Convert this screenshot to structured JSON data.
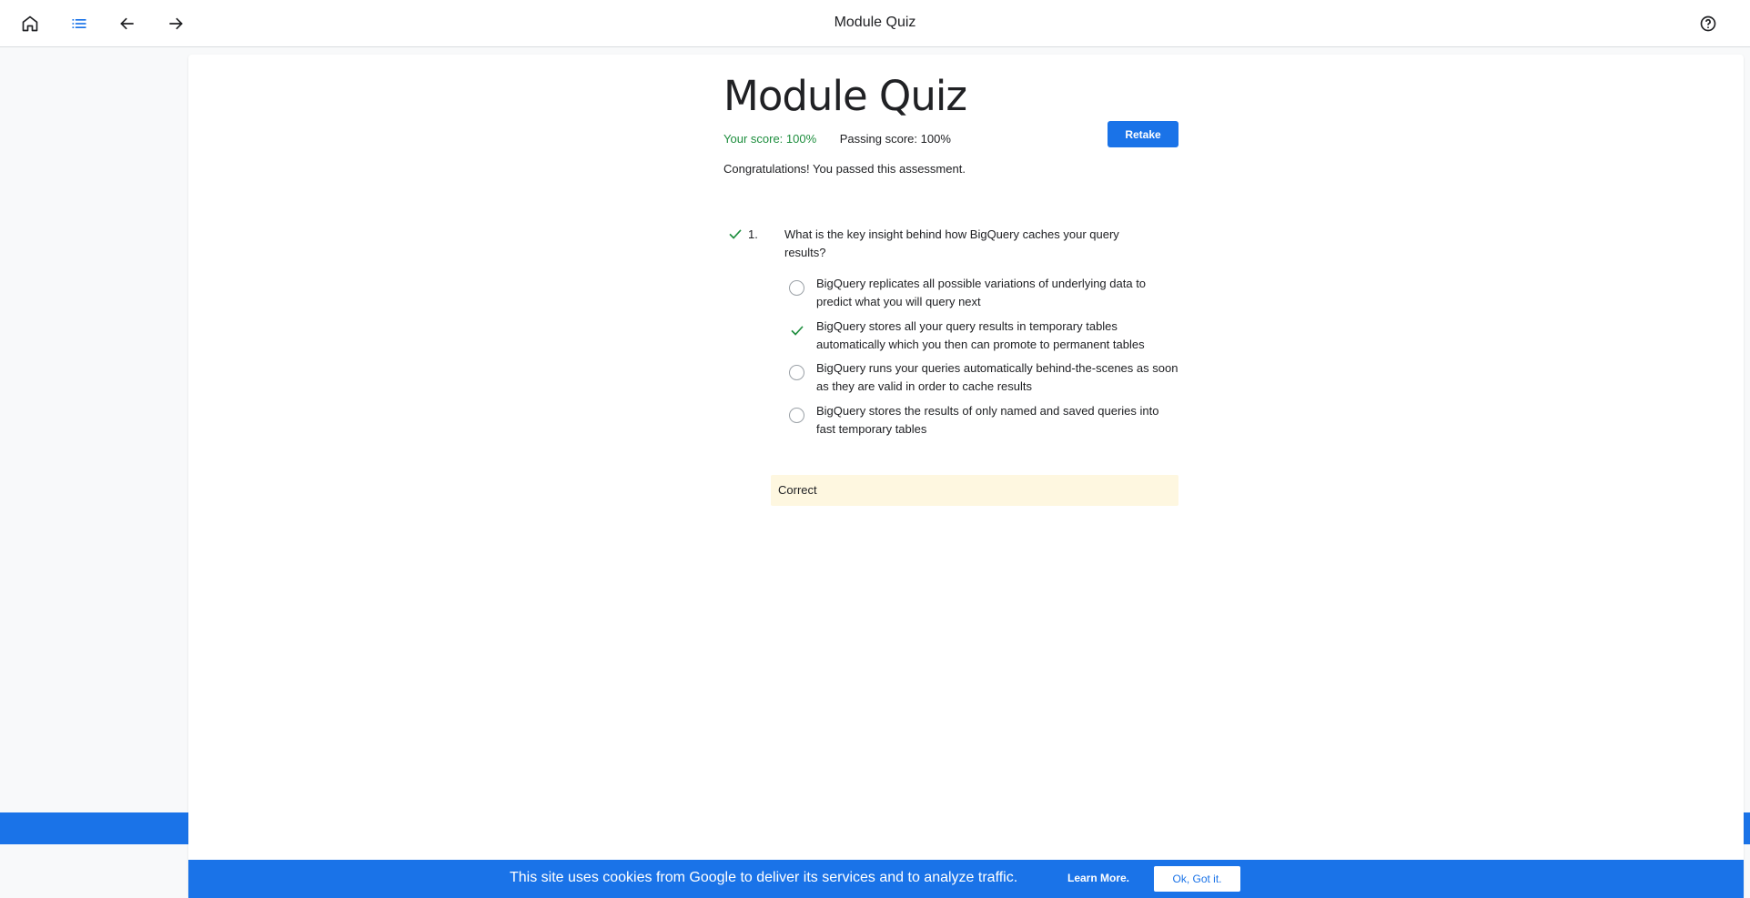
{
  "topbar": {
    "title": "Module Quiz",
    "icons": [
      "home-icon",
      "list-icon",
      "arrow-back-icon",
      "arrow-forward-icon",
      "help-icon"
    ]
  },
  "quiz": {
    "title": "Module Quiz",
    "your_score": "Your score: 100%",
    "passing_score": "Passing score: 100%",
    "retake_label": "Retake",
    "congrats": "Congratulations! You passed this assessment."
  },
  "question": {
    "number": "1.",
    "text": "What is the key insight behind how BigQuery caches your query results?",
    "options": [
      {
        "text": "BigQuery replicates all possible variations of underlying data to predict what you will query next",
        "selected": false
      },
      {
        "text": "BigQuery stores all your query results in temporary tables automatically which you then can promote to permanent tables",
        "selected": true
      },
      {
        "text": "BigQuery runs your queries automatically behind-the-scenes as soon as they are valid in order to cache results",
        "selected": false
      },
      {
        "text": "BigQuery stores the results of only named and saved queries into fast temporary tables",
        "selected": false
      }
    ],
    "feedback": "Correct"
  },
  "cookie": {
    "text": "This site uses cookies from Google to deliver its services and to analyze traffic.",
    "learn_more": "Learn More.",
    "ok": "Ok, Got it."
  },
  "colors": {
    "accent": "#1a73e8",
    "success": "#1e8e3e",
    "feedback_bg": "#fef7e0"
  }
}
